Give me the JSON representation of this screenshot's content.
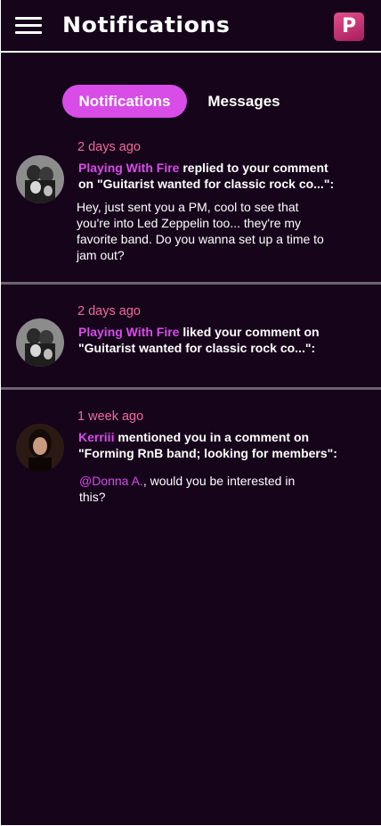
{
  "header": {
    "title": "Notifications",
    "logo_letter": "P",
    "menu_icon": "hamburger-menu-icon"
  },
  "tabs": [
    {
      "label": "Notifications",
      "active": true
    },
    {
      "label": "Messages",
      "active": false
    }
  ],
  "notifications": [
    {
      "time": "2 days ago",
      "actor": "Playing With Fire",
      "action_line1": " replied to your comment",
      "action_line2": "on \"Guitarist wanted for classic rock co...\":",
      "body": "Hey, just sent you a PM, cool to see that you're into Led Zeppelin too... they're my favorite band. Do you wanna set up a time to jam out?"
    },
    {
      "time": "2 days ago",
      "actor": "Playing With Fire",
      "action_line1": " liked your comment on",
      "action_line2": "\"Guitarist wanted for classic rock co...\":"
    },
    {
      "time": "1 week ago",
      "actor": "Kerriii",
      "action_line1": " mentioned you in a comment on",
      "action_line2": "\"Forming RnB band; looking for members\":",
      "mention": "@Donna A.",
      "body_rest": ", would you be interested in this?"
    }
  ],
  "colors": {
    "background": "#16041b",
    "accent": "#d84ce8",
    "timestamp": "#f06a9c"
  }
}
